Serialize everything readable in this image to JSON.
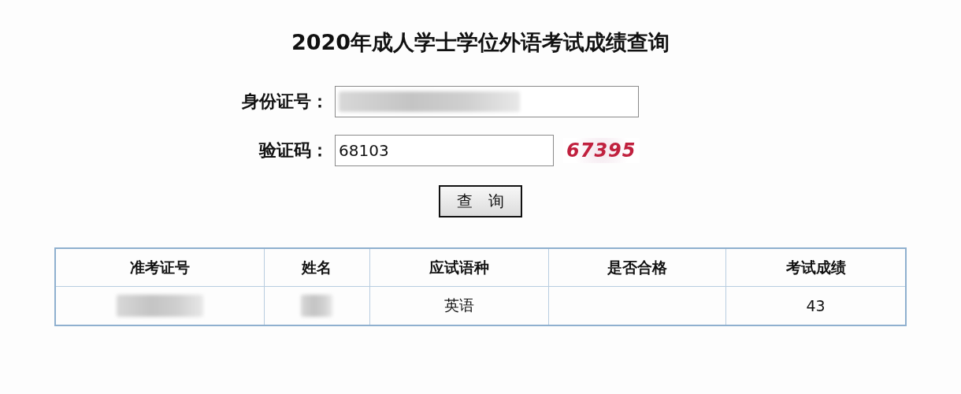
{
  "title": "2020年成人学士学位外语考试成绩查询",
  "form": {
    "fields": [
      {
        "label": "身份证号：",
        "redacted": true,
        "wide": true
      },
      {
        "label": "验证码：",
        "value": "68103",
        "wide": false
      }
    ],
    "captcha": "67395",
    "button": "查　询"
  },
  "table": {
    "columns": [
      "准考证号",
      "姓名",
      "应试语种",
      "是否合格",
      "考试成绩"
    ],
    "rows": [
      [
        {
          "redacted": true
        },
        {
          "redacted": true
        },
        {
          "text": "英语"
        },
        null,
        {
          "text": "43"
        }
      ]
    ]
  }
}
